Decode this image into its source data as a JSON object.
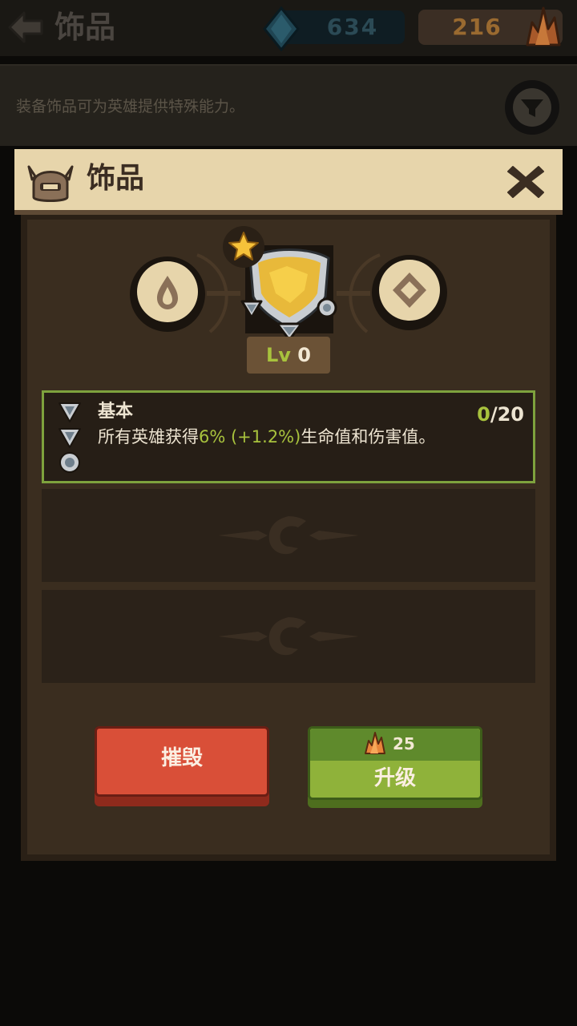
{
  "top_bar": {
    "title": "饰品",
    "gems": "634",
    "crystals": "216"
  },
  "hint": {
    "text": "装备饰品可为英雄提供特殊能力。"
  },
  "modal": {
    "title": "饰品",
    "level_prefix": "Lv",
    "level_value": "0",
    "stat": {
      "title": "基本",
      "desc_prefix": "所有英雄获得",
      "desc_highlight": "6% (+1.2%)",
      "desc_suffix": "生命值和伤害值。",
      "progress_current": "0",
      "progress_max": "/20"
    },
    "destroy_label": "摧毁",
    "upgrade_label": "升级",
    "upgrade_cost": "25"
  },
  "colors": {
    "accent_green": "#a8c23d",
    "destroy_red": "#d94f38",
    "header_parchment": "#e7d5ab",
    "panel_brown": "#3a2d1f"
  },
  "icons": [
    "back-arrow-icon",
    "gem-icon",
    "crystal-icon",
    "filter-icon",
    "helmet-icon",
    "close-icon",
    "drop-icon",
    "diamond-icon",
    "star-icon",
    "shield-icon",
    "triangle-gem-icon",
    "round-gem-icon",
    "crest-icon"
  ]
}
